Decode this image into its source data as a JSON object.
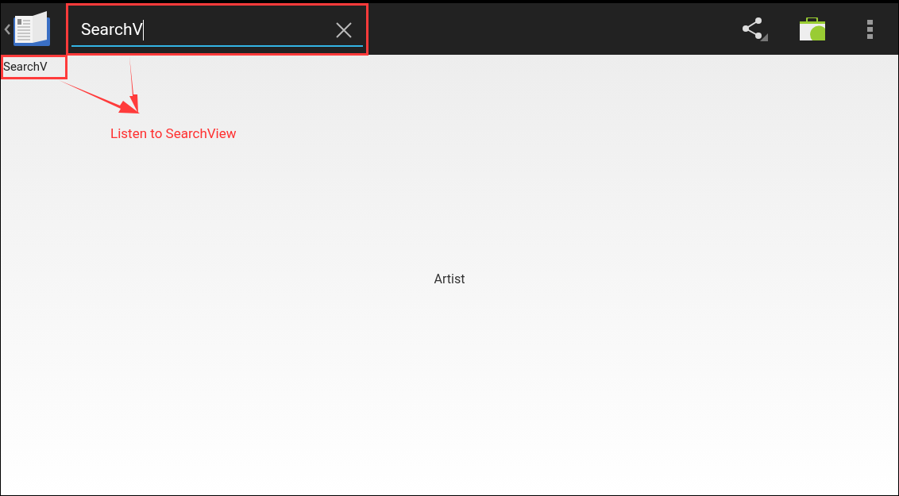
{
  "action_bar": {
    "search": {
      "value": "SearchV"
    }
  },
  "query_label": "SearchV",
  "annotation": {
    "label": "Listen to SearchView"
  },
  "content": {
    "text": "Artist"
  }
}
